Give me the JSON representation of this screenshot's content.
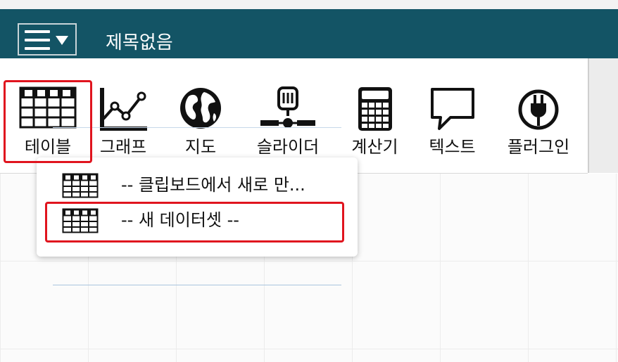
{
  "app": {
    "document_title": "제목없음"
  },
  "toolbar": {
    "tools": [
      {
        "id": "table",
        "label": "테이블"
      },
      {
        "id": "graph",
        "label": "그래프"
      },
      {
        "id": "map",
        "label": "지도"
      },
      {
        "id": "slider",
        "label": "슬라이더"
      },
      {
        "id": "calculator",
        "label": "계산기"
      },
      {
        "id": "text",
        "label": "텍스트"
      },
      {
        "id": "plugin",
        "label": "플러그인"
      }
    ]
  },
  "table_menu": {
    "items": [
      {
        "label": "-- 클립보드에서 새로 만..."
      },
      {
        "label": "-- 새 데이터셋 --"
      }
    ]
  },
  "colors": {
    "titlebar": "#135465",
    "highlight": "#e0141e"
  }
}
